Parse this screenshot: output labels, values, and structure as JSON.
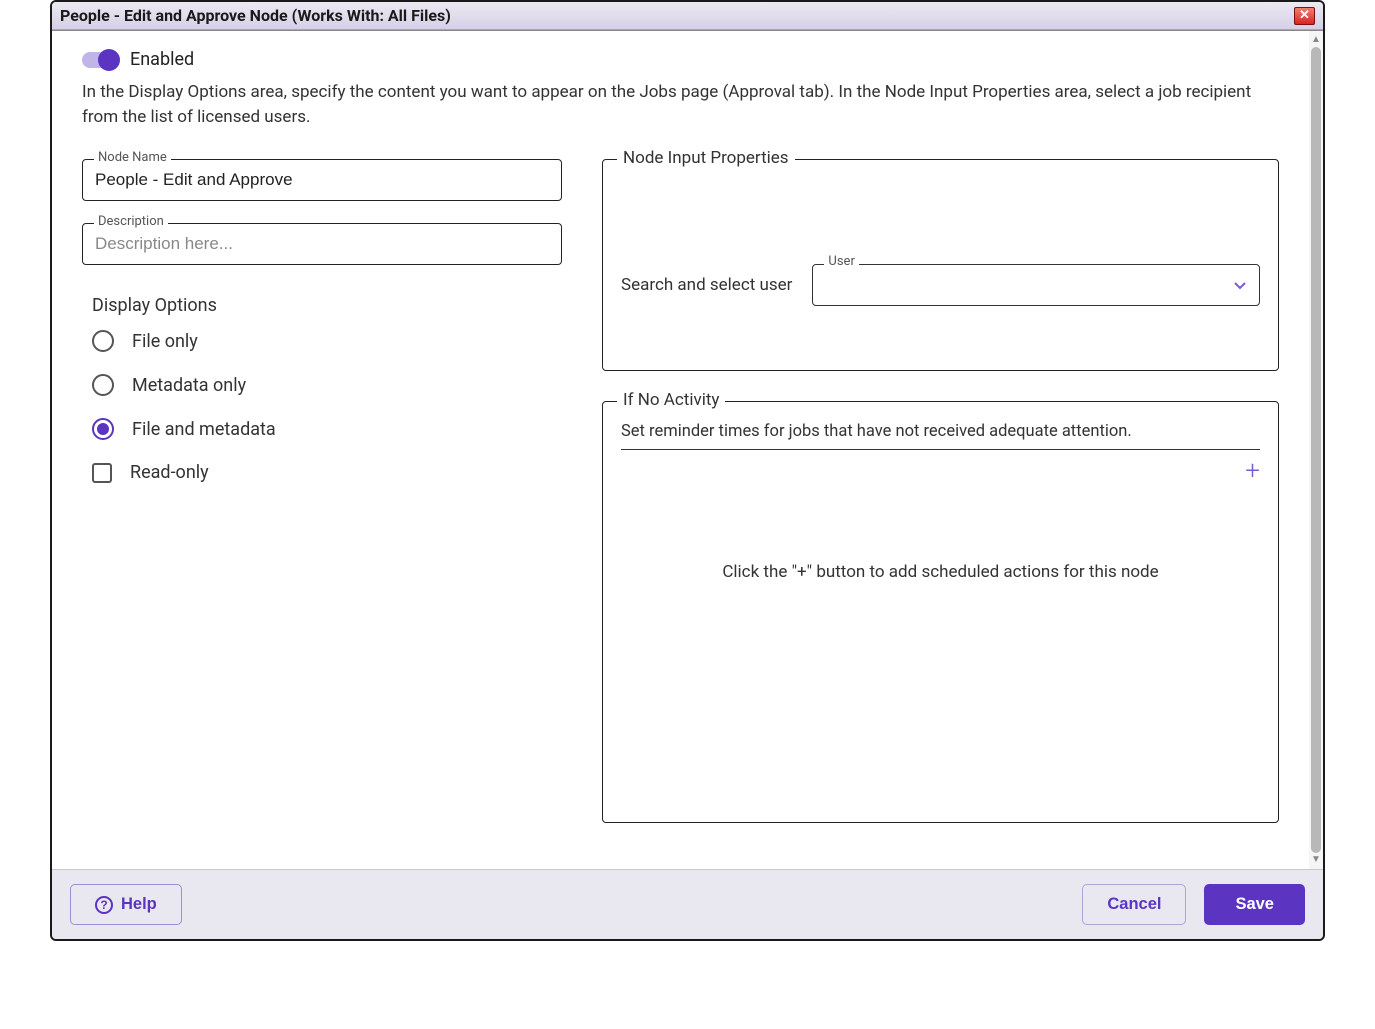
{
  "window": {
    "title": "People - Edit and Approve Node (Works With: All Files)"
  },
  "toggle": {
    "label": "Enabled",
    "on": true
  },
  "intro": "In the Display Options area, specify the content you want to appear on the Jobs page (Approval tab). In the Node Input Properties area, select a job recipient from the list of licensed users.",
  "fields": {
    "node_name": {
      "label": "Node Name",
      "value": "People - Edit and Approve"
    },
    "description": {
      "label": "Description",
      "placeholder": "Description here...",
      "value": ""
    }
  },
  "display_options": {
    "heading": "Display Options",
    "items": [
      {
        "label": "File only",
        "selected": false,
        "type": "radio"
      },
      {
        "label": "Metadata only",
        "selected": false,
        "type": "radio"
      },
      {
        "label": "File and metadata",
        "selected": true,
        "type": "radio"
      },
      {
        "label": "Read-only",
        "selected": false,
        "type": "checkbox"
      }
    ]
  },
  "node_input": {
    "legend": "Node Input Properties",
    "search_label": "Search and select user",
    "user_label": "User",
    "user_value": ""
  },
  "no_activity": {
    "legend": "If No Activity",
    "text": "Set reminder times for jobs that have not received adequate attention.",
    "empty_text": "Click the \"+\" button to add scheduled actions for this node"
  },
  "footer": {
    "help": "Help",
    "cancel": "Cancel",
    "save": "Save"
  }
}
